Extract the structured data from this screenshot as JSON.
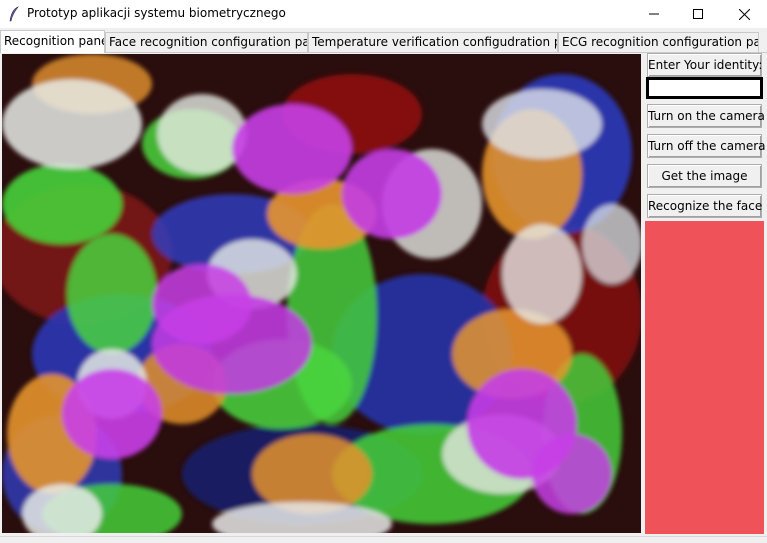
{
  "window": {
    "title": "Prototyp aplikacji systemu biometrycznego",
    "app_icon": "feather-icon",
    "controls": [
      "minimize-icon",
      "maximize-icon",
      "close-icon"
    ]
  },
  "tabs": [
    {
      "label": "Recognition panel",
      "active": true
    },
    {
      "label": "Face recognition configuration panel",
      "active": false
    },
    {
      "label": "Temperature verification configudration panel",
      "active": false
    },
    {
      "label": "ECG recognition configuration panel",
      "active": false
    }
  ],
  "sidebar": {
    "identity_label": "Enter Your identity:",
    "identity_value": "",
    "turn_on_label": "Turn on the camera",
    "turn_off_label": "Turn off the camera",
    "get_image_label": "Get the image",
    "recognize_label": "Recognize the face"
  },
  "colors": {
    "status_panel": "#f0525a",
    "canvas_background": "#2a0d0d"
  }
}
